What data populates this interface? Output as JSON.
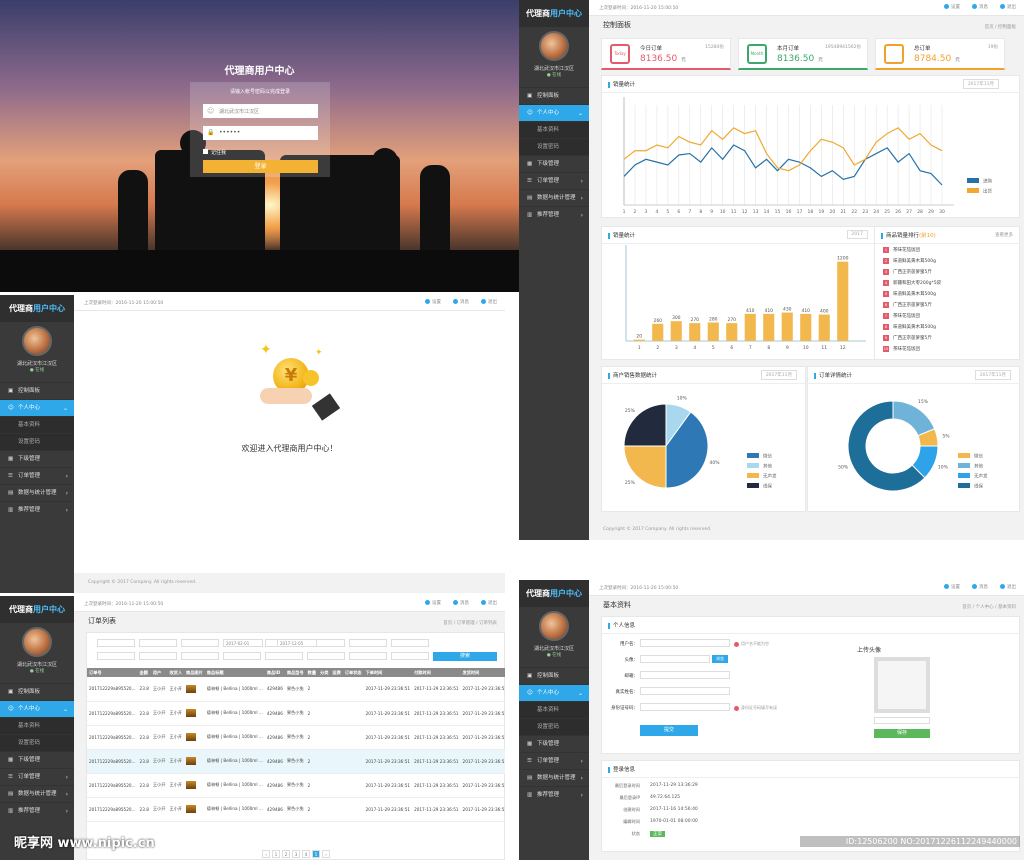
{
  "login": {
    "title": "代理商用户中心",
    "subtitle": "请输入帐号密码以完成登录",
    "username": "湖北武汉市江汉区",
    "password": "••••••",
    "remember": "记住我",
    "submit": "登录"
  },
  "common": {
    "logo_a": "代理商",
    "logo_b": "用户中心",
    "location": "湖北武汉市江汉区",
    "status": "● 在线",
    "lastlogin": "上次登录时间：2016-11-20  15:00:50",
    "settings": "设置",
    "messages": "消息",
    "exit": "退出",
    "footer": "Copyright © 2017 Company. All rights reserved."
  },
  "menu": [
    {
      "label": "控制面板",
      "icon": "▣",
      "type": "item"
    },
    {
      "label": "个人中心",
      "icon": "☺",
      "type": "active",
      "arrow": "⌄"
    },
    {
      "label": "基本资料",
      "type": "sub"
    },
    {
      "label": "设置密码",
      "type": "sub"
    },
    {
      "label": "下级管理",
      "icon": "▦",
      "type": "item"
    },
    {
      "label": "订单管理",
      "icon": "☰",
      "type": "item",
      "arrow": "›"
    },
    {
      "label": "数据与统计管理",
      "icon": "▤",
      "type": "item",
      "arrow": "›"
    },
    {
      "label": "推荐管理",
      "icon": "▥",
      "type": "item",
      "arrow": "›"
    }
  ],
  "dashboard": {
    "page_title": "控制面板",
    "breadcrumb": "首页 / 控制面板",
    "stats": [
      {
        "icon_label": "Today",
        "label": "今日订单",
        "count": "15284份",
        "value": "8136.50",
        "unit": "元",
        "color": "#e35a6a"
      },
      {
        "icon_label": "Month",
        "label": "本月订单",
        "count": "19548941562份",
        "value": "8136.50",
        "unit": "元",
        "color": "#3aa86a"
      },
      {
        "icon_label": "",
        "label": "总订单",
        "count": "19份",
        "value": "8784.50",
        "unit": "元",
        "color": "#f2a12c"
      }
    ],
    "line_title": "销量统计",
    "line_date": "2017年11月",
    "bar_title": "销量统计",
    "bar_year": "2017",
    "rank_title": "商品销量排行",
    "rank_badge": "(前10)",
    "rank_more": "查看更多",
    "rank": [
      "茶味花茄饭团",
      "味道鲜美黄木耳500g",
      "广西正宗菠萝蜜5斤",
      "新疆和田大枣200g*5袋",
      "味道鲜美黄木耳500g",
      "广西正宗菠萝蜜5斤",
      "茶味花茄饭团",
      "味道鲜美黄木耳500g",
      "广西正宗菠萝蜜5斤",
      "茶味花茄饭团"
    ],
    "pie_title": "商户销售数据统计",
    "pie_date": "2017年11月",
    "donut_title": "订单详情统计",
    "donut_date": "2017年11月"
  },
  "chart_data": [
    {
      "type": "line",
      "x": [
        1,
        2,
        3,
        4,
        5,
        6,
        7,
        8,
        9,
        10,
        11,
        12,
        13,
        14,
        15,
        16,
        17,
        18,
        19,
        20,
        21,
        22,
        23,
        24,
        25,
        26,
        27,
        28,
        29,
        30
      ],
      "series": [
        {
          "name": "进购",
          "color": "#2672a8",
          "values": [
            40,
            48,
            52,
            50,
            48,
            55,
            56,
            50,
            60,
            52,
            62,
            58,
            46,
            52,
            44,
            52,
            50,
            46,
            40,
            44,
            38,
            40,
            52,
            56,
            60,
            50,
            56,
            44,
            42,
            34
          ]
        },
        {
          "name": "出货",
          "color": "#f0a830",
          "values": [
            52,
            58,
            58,
            62,
            60,
            68,
            64,
            62,
            72,
            66,
            74,
            70,
            72,
            56,
            46,
            44,
            48,
            58,
            66,
            64,
            60,
            48,
            52,
            64,
            70,
            74,
            66,
            70,
            62,
            58
          ]
        }
      ],
      "ylim": [
        20,
        90
      ]
    },
    {
      "type": "bar",
      "categories": [
        "1",
        "2",
        "3",
        "4",
        "5",
        "6",
        "7",
        "8",
        "9",
        "10",
        "11",
        "12"
      ],
      "values": [
        20,
        260,
        300,
        270,
        280,
        270,
        410,
        410,
        430,
        410,
        400,
        1200
      ],
      "ylim": [
        0,
        1300
      ]
    },
    {
      "type": "pie",
      "slices": [
        {
          "name": "微信",
          "value": 40,
          "color": "#2e79b5"
        },
        {
          "name": "其他",
          "value": 10,
          "color": "#a8d7ee"
        },
        {
          "name": "无声发",
          "value": 25,
          "color": "#f2b84d"
        },
        {
          "name": "线保",
          "value": 25,
          "color": "#222b3e"
        }
      ]
    },
    {
      "type": "pie",
      "variant": "donut",
      "slices": [
        {
          "name": "微信",
          "value": 5,
          "color": "#f2b84d"
        },
        {
          "name": "其他",
          "value": 15,
          "color": "#6fb4d8"
        },
        {
          "name": "无声发",
          "value": 10,
          "color": "#2fa3ea"
        },
        {
          "name": "线保",
          "value": 50,
          "color": "#1e6e9a"
        }
      ],
      "labels": [
        "5%",
        "15%",
        "10%",
        "50%"
      ]
    }
  ],
  "welcome": {
    "text": "欢迎进入代理商用户中心！"
  },
  "orders": {
    "page_title": "订单列表",
    "breadcrumb": "首页 / 订单管理 / 订单列表",
    "date_from": "2017-02-01",
    "date_to": "2017-12-05",
    "search": "搜索",
    "headers": [
      "订单号",
      "金额",
      "用户",
      "收货人",
      "商品图片",
      "商品标题",
      "商品ID",
      "商品型号",
      "数量",
      "分类",
      "运费",
      "订单状态",
      "下单时间",
      "付款时间",
      "发货时间",
      "用户ID"
    ],
    "rows": [
      [
        "201712229a895520... ",
        "23.8",
        "王小开",
        "王小开",
        "",
        "德林顿 | Bellina | 1000ml ...",
        "429486",
        "果色小兔",
        "2",
        "",
        "",
        "",
        "2017-11-29 23:36:51",
        "2017-11-29 23:36:51",
        "2017-11-29 23:36:51",
        "SS122"
      ],
      [
        "201712229a895520...",
        "23.8",
        "王小开",
        "王小开",
        "",
        "德林顿 | Bellina | 1000ml ...",
        "429486",
        "果色小兔",
        "2",
        "",
        "",
        "",
        "2017-11-29 23:36:51",
        "2017-11-29 23:36:51",
        "2017-11-29 23:36:51",
        "SS122"
      ],
      [
        "201712229a895520...",
        "23.8",
        "王小开",
        "王小开",
        "",
        "德林顿 | Bellina | 1000ml ...",
        "429486",
        "果色小兔",
        "2",
        "",
        "",
        "",
        "2017-11-29 23:36:51",
        "2017-11-29 23:36:51",
        "2017-11-29 23:36:51",
        "SS122"
      ],
      [
        "201712229a895520...",
        "23.8",
        "王小开",
        "王小开",
        "",
        "德林顿 | Bellina | 1000ml ...",
        "429486",
        "果色小兔",
        "2",
        "",
        "",
        "",
        "2017-11-29 23:36:51",
        "2017-11-29 23:36:51",
        "2017-11-29 23:36:51",
        "SS122"
      ],
      [
        "201712229a895520...",
        "23.8",
        "王小开",
        "王小开",
        "",
        "德林顿 | Bellina | 1000ml ...",
        "429486",
        "果色小兔",
        "2",
        "",
        "",
        "",
        "2017-11-29 23:36:51",
        "2017-11-29 23:36:51",
        "2017-11-29 23:36:51",
        "SS122"
      ],
      [
        "201712229a895520...",
        "23.8",
        "王小开",
        "王小开",
        "",
        "德林顿 | Bellina | 1000ml ...",
        "429486",
        "果色小兔",
        "2",
        "",
        "",
        "",
        "2017-11-29 23:36:51",
        "2017-11-29 23:36:51",
        "2017-11-29 23:36:51",
        "SS122"
      ]
    ],
    "pages": [
      "‹",
      "1",
      "2",
      "3",
      "4",
      "5",
      "›"
    ]
  },
  "profile": {
    "page_title": "基本资料",
    "breadcrumb": "首页 / 个人中心 / 基本资料",
    "section": "个人信息",
    "fields": [
      "用户名：",
      "头像：",
      "邮箱：",
      "真实姓名：",
      "身份证号码："
    ],
    "hint1": "用户名不能为空",
    "hint2": "身份证号码填写有误",
    "upload_btn": "浏览",
    "submit": "提交",
    "avatar_title": "上传头像",
    "save": "保存",
    "login_section": "登录信息",
    "login_info": [
      [
        "最后登录时间",
        "2017-11-29 13:36:29"
      ],
      [
        "最后登录IP",
        "49.72.64.125"
      ],
      [
        "创建时间",
        "2017-11-16 14:56:40"
      ],
      [
        "编辑时间",
        "1970-01-01 08:00:00"
      ],
      [
        "状态",
        "正常"
      ]
    ]
  },
  "watermark": {
    "left": "昵享网 www.nipic.cn",
    "right": "ID:12506200 NO:20171226112249440000"
  }
}
